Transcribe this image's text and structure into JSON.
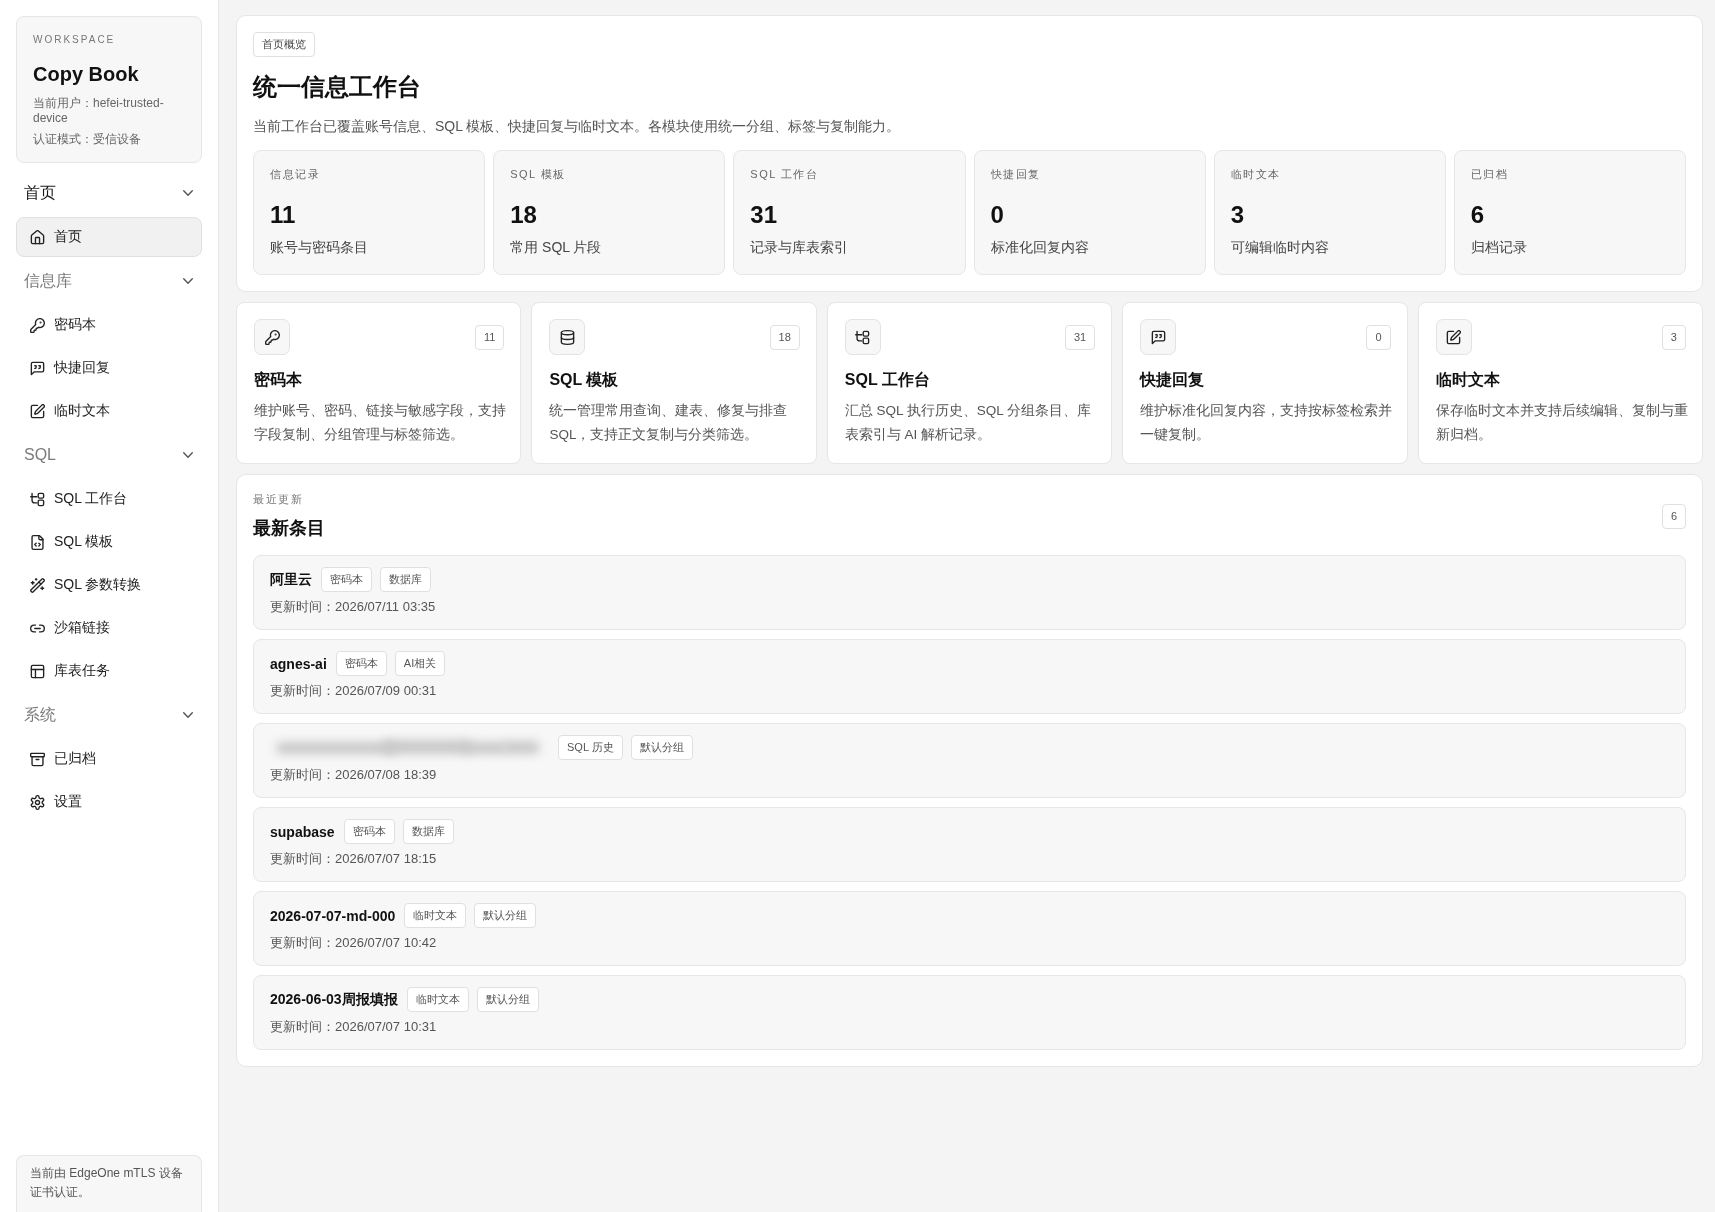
{
  "sidebar": {
    "workspace": {
      "label": "WORKSPACE",
      "name": "Copy Book",
      "user": "当前用户：hefei-trusted-device",
      "auth_mode": "认证模式：受信设备"
    },
    "sections": [
      {
        "title": "首页",
        "active": true,
        "expanded": true,
        "items": [
          {
            "label": "首页",
            "selected": true
          }
        ]
      },
      {
        "title": "信息库",
        "active": false,
        "expanded": true,
        "items": [
          {
            "label": "密码本",
            "selected": false
          },
          {
            "label": "快捷回复",
            "selected": false
          },
          {
            "label": "临时文本",
            "selected": false
          }
        ]
      },
      {
        "title": "SQL",
        "active": false,
        "expanded": true,
        "items": [
          {
            "label": "SQL 工作台",
            "selected": false
          },
          {
            "label": "SQL 模板",
            "selected": false
          },
          {
            "label": "SQL 参数转换",
            "selected": false
          },
          {
            "label": "沙箱链接",
            "selected": false
          },
          {
            "label": "库表任务",
            "selected": false
          }
        ]
      },
      {
        "title": "系统",
        "active": false,
        "expanded": true,
        "items": [
          {
            "label": "已归档",
            "selected": false
          },
          {
            "label": "设置",
            "selected": false
          }
        ]
      }
    ],
    "footer": "当前由 EdgeOne mTLS 设备证书认证。"
  },
  "overview": {
    "badge": "首页概览",
    "title": "统一信息工作台",
    "description": "当前工作台已覆盖账号信息、SQL 模板、快捷回复与临时文本。各模块使用统一分组、标签与复制能力。",
    "stats": [
      {
        "label": "信息记录",
        "value": "11",
        "caption": "账号与密码条目"
      },
      {
        "label": "SQL 模板",
        "value": "18",
        "caption": "常用 SQL 片段"
      },
      {
        "label": "SQL 工作台",
        "value": "31",
        "caption": "记录与库表索引"
      },
      {
        "label": "快捷回复",
        "value": "0",
        "caption": "标准化回复内容"
      },
      {
        "label": "临时文本",
        "value": "3",
        "caption": "可编辑临时内容"
      },
      {
        "label": "已归档",
        "value": "6",
        "caption": "归档记录"
      }
    ]
  },
  "modules": [
    {
      "title": "密码本",
      "count": "11",
      "description": "维护账号、密码、链接与敏感字段，支持字段复制、分组管理与标签筛选。"
    },
    {
      "title": "SQL 模板",
      "count": "18",
      "description": "统一管理常用查询、建表、修复与排查 SQL，支持正文复制与分类筛选。"
    },
    {
      "title": "SQL 工作台",
      "count": "31",
      "description": "汇总 SQL 执行历史、SQL 分组条目、库表索引与 AI 解析记录。"
    },
    {
      "title": "快捷回复",
      "count": "0",
      "description": "维护标准化回复内容，支持按标签检索并一键复制。"
    },
    {
      "title": "临时文本",
      "count": "3",
      "description": "保存临时文本并支持后续编辑、复制与重新归档。"
    }
  ],
  "recent": {
    "eyebrow": "最近更新",
    "title": "最新条目",
    "count": "6",
    "entries": [
      {
        "title": "阿里云",
        "blurred": false,
        "tags": [
          "密码本",
          "数据库"
        ],
        "updated": "更新时间：2026/07/11 03:35"
      },
      {
        "title": "agnes-ai",
        "blurred": false,
        "tags": [
          "密码本",
          "AI相关"
        ],
        "updated": "更新时间：2026/07/09 00:31"
      },
      {
        "blurred": true,
        "tags": [
          "SQL 历史",
          "默认分组"
        ],
        "updated": "更新时间：2026/07/08 18:39"
      },
      {
        "title": "supabase",
        "blurred": false,
        "tags": [
          "密码本",
          "数据库"
        ],
        "updated": "更新时间：2026/07/07 18:15"
      },
      {
        "title": "2026-07-07-md-000",
        "blurred": false,
        "tags": [
          "临时文本",
          "默认分组"
        ],
        "updated": "更新时间：2026/07/07 10:42"
      },
      {
        "title": "2026-06-03周报填报",
        "blurred": false,
        "tags": [
          "临时文本",
          "默认分组"
        ],
        "updated": "更新时间：2026/07/07 10:31"
      }
    ]
  }
}
